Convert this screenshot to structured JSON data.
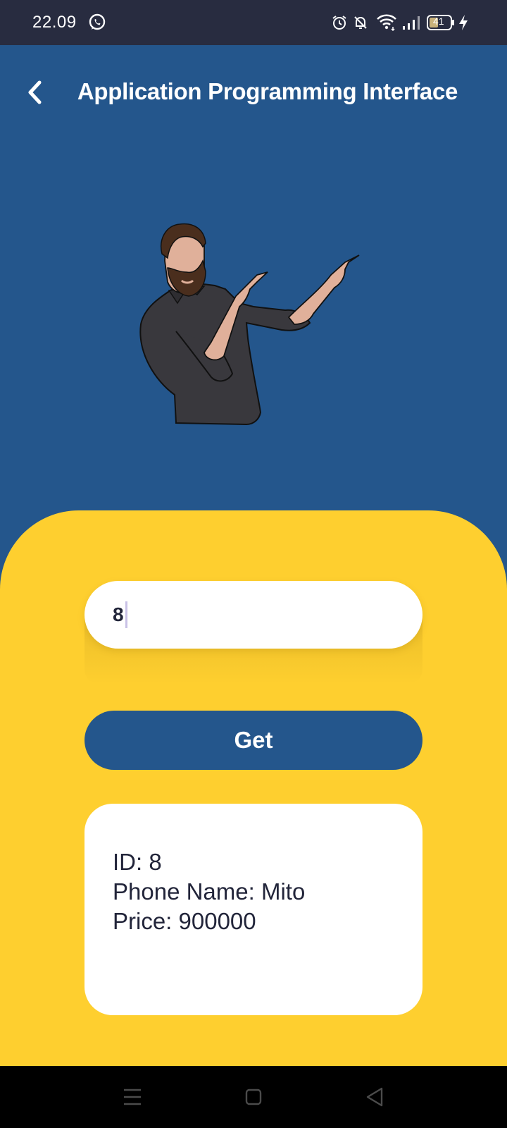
{
  "status_bar": {
    "time": "22.09",
    "battery_level": "41",
    "icons": [
      "whatsapp-icon",
      "alarm-icon",
      "bell-off-icon",
      "wifi-icon",
      "signal-icon",
      "battery-icon",
      "charging-icon"
    ]
  },
  "header": {
    "title": "Application Programming Interface",
    "back_icon": "chevron-left-icon"
  },
  "illustration": {
    "subject": "bearded man pointing"
  },
  "form": {
    "id_input_value": "8",
    "get_button_label": "Get"
  },
  "result": {
    "lines": [
      "ID: 8",
      "Phone Name: Mito",
      "Price: 900000"
    ]
  },
  "nav_bar": {
    "icons": [
      "menu-icon",
      "home-square-icon",
      "back-triangle-icon"
    ]
  },
  "colors": {
    "primary_blue": "#24568C",
    "accent_yellow": "#FECF2F",
    "status_bar": "#282C40",
    "text_dark": "#22253A"
  }
}
